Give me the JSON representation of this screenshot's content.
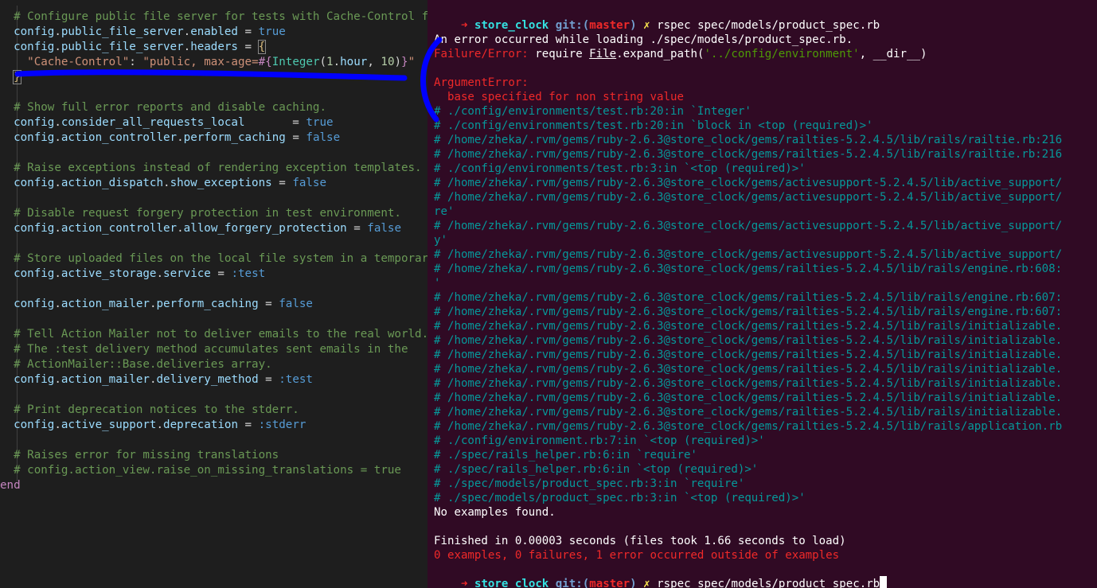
{
  "editor": {
    "lines": [
      [
        {
          "t": "  # Configure public file server for tests with Cache-Control fo",
          "c": "c-comment"
        }
      ],
      [
        {
          "t": "  config",
          "c": "c-ident"
        },
        {
          "t": ".",
          "c": ""
        },
        {
          "t": "public_file_server",
          "c": "c-ident"
        },
        {
          "t": ".",
          "c": ""
        },
        {
          "t": "enabled",
          "c": "c-ident"
        },
        {
          "t": " = ",
          "c": ""
        },
        {
          "t": "true",
          "c": "c-const"
        }
      ],
      [
        {
          "t": "  config",
          "c": "c-ident"
        },
        {
          "t": ".",
          "c": ""
        },
        {
          "t": "public_file_server",
          "c": "c-ident"
        },
        {
          "t": ".",
          "c": ""
        },
        {
          "t": "headers",
          "c": "c-ident"
        },
        {
          "t": " = ",
          "c": ""
        },
        {
          "t": "{",
          "c": "c-brace bracket-box"
        }
      ],
      [
        {
          "t": "    \"Cache-Control\"",
          "c": "c-str"
        },
        {
          "t": ": ",
          "c": ""
        },
        {
          "t": "\"public, max-age=",
          "c": "c-str"
        },
        {
          "t": "#{",
          "c": "c-kw"
        },
        {
          "t": "Integer",
          "c": "c-class"
        },
        {
          "t": "(",
          "c": ""
        },
        {
          "t": "1",
          "c": "c-num"
        },
        {
          "t": ".",
          "c": ""
        },
        {
          "t": "hour",
          "c": "c-ident"
        },
        {
          "t": ", ",
          "c": ""
        },
        {
          "t": "10",
          "c": "c-num"
        },
        {
          "t": ")",
          "c": ""
        },
        {
          "t": "}",
          "c": "c-kw"
        },
        {
          "t": "\"",
          "c": "c-str"
        }
      ],
      [
        {
          "t": "  ",
          "c": ""
        },
        {
          "t": "}",
          "c": "c-brace bracket-box"
        }
      ],
      [],
      [
        {
          "t": "  # Show full error reports and disable caching.",
          "c": "c-comment"
        }
      ],
      [
        {
          "t": "  config",
          "c": "c-ident"
        },
        {
          "t": ".",
          "c": ""
        },
        {
          "t": "consider_all_requests_local",
          "c": "c-ident"
        },
        {
          "t": "       = ",
          "c": ""
        },
        {
          "t": "true",
          "c": "c-const"
        }
      ],
      [
        {
          "t": "  config",
          "c": "c-ident"
        },
        {
          "t": ".",
          "c": ""
        },
        {
          "t": "action_controller",
          "c": "c-ident"
        },
        {
          "t": ".",
          "c": ""
        },
        {
          "t": "perform_caching",
          "c": "c-ident"
        },
        {
          "t": " = ",
          "c": ""
        },
        {
          "t": "false",
          "c": "c-const"
        }
      ],
      [],
      [
        {
          "t": "  # Raise exceptions instead of rendering exception templates.",
          "c": "c-comment"
        }
      ],
      [
        {
          "t": "  config",
          "c": "c-ident"
        },
        {
          "t": ".",
          "c": ""
        },
        {
          "t": "action_dispatch",
          "c": "c-ident"
        },
        {
          "t": ".",
          "c": ""
        },
        {
          "t": "show_exceptions",
          "c": "c-ident"
        },
        {
          "t": " = ",
          "c": ""
        },
        {
          "t": "false",
          "c": "c-const"
        }
      ],
      [],
      [
        {
          "t": "  # Disable request forgery protection in test environment.",
          "c": "c-comment"
        }
      ],
      [
        {
          "t": "  config",
          "c": "c-ident"
        },
        {
          "t": ".",
          "c": ""
        },
        {
          "t": "action_controller",
          "c": "c-ident"
        },
        {
          "t": ".",
          "c": ""
        },
        {
          "t": "allow_forgery_protection",
          "c": "c-ident"
        },
        {
          "t": " = ",
          "c": ""
        },
        {
          "t": "false",
          "c": "c-const"
        }
      ],
      [],
      [
        {
          "t": "  # Store uploaded files on the local file system in a temporary",
          "c": "c-comment"
        }
      ],
      [
        {
          "t": "  config",
          "c": "c-ident"
        },
        {
          "t": ".",
          "c": ""
        },
        {
          "t": "active_storage",
          "c": "c-ident"
        },
        {
          "t": ".",
          "c": ""
        },
        {
          "t": "service",
          "c": "c-ident"
        },
        {
          "t": " = ",
          "c": ""
        },
        {
          "t": ":test",
          "c": "c-sym"
        }
      ],
      [],
      [
        {
          "t": "  config",
          "c": "c-ident"
        },
        {
          "t": ".",
          "c": ""
        },
        {
          "t": "action_mailer",
          "c": "c-ident"
        },
        {
          "t": ".",
          "c": ""
        },
        {
          "t": "perform_caching",
          "c": "c-ident"
        },
        {
          "t": " = ",
          "c": ""
        },
        {
          "t": "false",
          "c": "c-const"
        }
      ],
      [],
      [
        {
          "t": "  # Tell Action Mailer not to deliver emails to the real world.",
          "c": "c-comment"
        }
      ],
      [
        {
          "t": "  # The :test delivery method accumulates sent emails in the",
          "c": "c-comment"
        }
      ],
      [
        {
          "t": "  # ActionMailer::Base.deliveries array.",
          "c": "c-comment"
        }
      ],
      [
        {
          "t": "  config",
          "c": "c-ident"
        },
        {
          "t": ".",
          "c": ""
        },
        {
          "t": "action_mailer",
          "c": "c-ident"
        },
        {
          "t": ".",
          "c": ""
        },
        {
          "t": "delivery_method",
          "c": "c-ident"
        },
        {
          "t": " = ",
          "c": ""
        },
        {
          "t": ":test",
          "c": "c-sym"
        }
      ],
      [],
      [
        {
          "t": "  # Print deprecation notices to the stderr.",
          "c": "c-comment"
        }
      ],
      [
        {
          "t": "  config",
          "c": "c-ident"
        },
        {
          "t": ".",
          "c": ""
        },
        {
          "t": "active_support",
          "c": "c-ident"
        },
        {
          "t": ".",
          "c": ""
        },
        {
          "t": "deprecation",
          "c": "c-ident"
        },
        {
          "t": " = ",
          "c": ""
        },
        {
          "t": ":stderr",
          "c": "c-sym"
        }
      ],
      [],
      [
        {
          "t": "  # Raises error for missing translations",
          "c": "c-comment"
        }
      ],
      [
        {
          "t": "  # config.action_view.raise_on_missing_translations = true",
          "c": "c-comment"
        }
      ],
      [
        {
          "t": "end",
          "c": "c-kw"
        }
      ]
    ]
  },
  "terminal": {
    "prompt": {
      "arrow": "➜",
      "dir": "store_clock",
      "git_label": "git:(",
      "branch": "master",
      "git_close": ")",
      "dirty": "✗",
      "command": "rspec spec/models/product_spec.rb"
    },
    "lines": [
      [],
      [
        {
          "t": "An error occurred while loading ./spec/models/product_spec.rb.",
          "c": ""
        }
      ],
      [
        {
          "t": "Failure/Error: ",
          "c": "t-red"
        },
        {
          "t": "require ",
          "c": ""
        },
        {
          "t": "File",
          "c": "t-file"
        },
        {
          "t": ".expand_path(",
          "c": ""
        },
        {
          "t": "'../config/environment'",
          "c": "t-strg"
        },
        {
          "t": ", __dir__)",
          "c": ""
        }
      ],
      [],
      [
        {
          "t": "ArgumentError:",
          "c": "t-red"
        }
      ],
      [
        {
          "t": "  base specified for non string value",
          "c": "t-red"
        }
      ],
      [
        {
          "t": "# ./config/environments/test.rb:20:in `Integer'",
          "c": "t-cyan"
        }
      ],
      [
        {
          "t": "# ./config/environments/test.rb:20:in `block in <top (required)>'",
          "c": "t-cyan"
        }
      ],
      [
        {
          "t": "# /home/zheka/.rvm/gems/ruby-2.6.3@store_clock/gems/railties-5.2.4.5/lib/rails/railtie.rb:216",
          "c": "t-cyan"
        }
      ],
      [
        {
          "t": "# /home/zheka/.rvm/gems/ruby-2.6.3@store_clock/gems/railties-5.2.4.5/lib/rails/railtie.rb:216",
          "c": "t-cyan"
        }
      ],
      [
        {
          "t": "# ./config/environments/test.rb:3:in `<top (required)>'",
          "c": "t-cyan"
        }
      ],
      [
        {
          "t": "# /home/zheka/.rvm/gems/ruby-2.6.3@store_clock/gems/activesupport-5.2.4.5/lib/active_support/",
          "c": "t-cyan"
        }
      ],
      [
        {
          "t": "# /home/zheka/.rvm/gems/ruby-2.6.3@store_clock/gems/activesupport-5.2.4.5/lib/active_support/",
          "c": "t-cyan"
        }
      ],
      [
        {
          "t": "re'",
          "c": "t-cyan"
        }
      ],
      [
        {
          "t": "# /home/zheka/.rvm/gems/ruby-2.6.3@store_clock/gems/activesupport-5.2.4.5/lib/active_support/",
          "c": "t-cyan"
        }
      ],
      [
        {
          "t": "y'",
          "c": "t-cyan"
        }
      ],
      [
        {
          "t": "# /home/zheka/.rvm/gems/ruby-2.6.3@store_clock/gems/activesupport-5.2.4.5/lib/active_support/",
          "c": "t-cyan"
        }
      ],
      [
        {
          "t": "# /home/zheka/.rvm/gems/ruby-2.6.3@store_clock/gems/railties-5.2.4.5/lib/rails/engine.rb:608:",
          "c": "t-cyan"
        }
      ],
      [
        {
          "t": "'",
          "c": "t-cyan"
        }
      ],
      [
        {
          "t": "# /home/zheka/.rvm/gems/ruby-2.6.3@store_clock/gems/railties-5.2.4.5/lib/rails/engine.rb:607:",
          "c": "t-cyan"
        }
      ],
      [
        {
          "t": "# /home/zheka/.rvm/gems/ruby-2.6.3@store_clock/gems/railties-5.2.4.5/lib/rails/engine.rb:607:",
          "c": "t-cyan"
        }
      ],
      [
        {
          "t": "# /home/zheka/.rvm/gems/ruby-2.6.3@store_clock/gems/railties-5.2.4.5/lib/rails/initializable.",
          "c": "t-cyan"
        }
      ],
      [
        {
          "t": "# /home/zheka/.rvm/gems/ruby-2.6.3@store_clock/gems/railties-5.2.4.5/lib/rails/initializable.",
          "c": "t-cyan"
        }
      ],
      [
        {
          "t": "# /home/zheka/.rvm/gems/ruby-2.6.3@store_clock/gems/railties-5.2.4.5/lib/rails/initializable.",
          "c": "t-cyan"
        }
      ],
      [
        {
          "t": "# /home/zheka/.rvm/gems/ruby-2.6.3@store_clock/gems/railties-5.2.4.5/lib/rails/initializable.",
          "c": "t-cyan"
        }
      ],
      [
        {
          "t": "# /home/zheka/.rvm/gems/ruby-2.6.3@store_clock/gems/railties-5.2.4.5/lib/rails/initializable.",
          "c": "t-cyan"
        }
      ],
      [
        {
          "t": "# /home/zheka/.rvm/gems/ruby-2.6.3@store_clock/gems/railties-5.2.4.5/lib/rails/initializable.",
          "c": "t-cyan"
        }
      ],
      [
        {
          "t": "# /home/zheka/.rvm/gems/ruby-2.6.3@store_clock/gems/railties-5.2.4.5/lib/rails/initializable.",
          "c": "t-cyan"
        }
      ],
      [
        {
          "t": "# /home/zheka/.rvm/gems/ruby-2.6.3@store_clock/gems/railties-5.2.4.5/lib/rails/application.rb",
          "c": "t-cyan"
        }
      ],
      [
        {
          "t": "# ./config/environment.rb:7:in `<top (required)>'",
          "c": "t-cyan"
        }
      ],
      [
        {
          "t": "# ./spec/rails_helper.rb:6:in `require'",
          "c": "t-cyan"
        }
      ],
      [
        {
          "t": "# ./spec/rails_helper.rb:6:in `<top (required)>'",
          "c": "t-cyan"
        }
      ],
      [
        {
          "t": "# ./spec/models/product_spec.rb:3:in `require'",
          "c": "t-cyan"
        }
      ],
      [
        {
          "t": "# ./spec/models/product_spec.rb:3:in `<top (required)>'",
          "c": "t-cyan"
        }
      ],
      [
        {
          "t": "No examples found.",
          "c": ""
        }
      ],
      [],
      [
        {
          "t": "Finished in 0.00003 seconds (files took 1.66 seconds to load)",
          "c": ""
        }
      ],
      [
        {
          "t": "0 examples, 0 failures, 1 error occurred outside of examples",
          "c": "t-red"
        }
      ]
    ]
  },
  "colors": {
    "editor_bg": "#1e1e1e",
    "terminal_bg": "#300a24",
    "annotation": "#0000ff"
  }
}
